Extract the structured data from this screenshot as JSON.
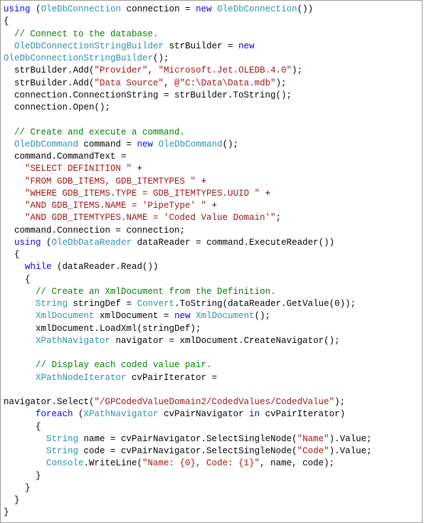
{
  "code": {
    "keywords": {
      "using": "using",
      "new": "new",
      "while": "while",
      "foreach": "foreach",
      "in": "in"
    },
    "types": {
      "OleDbConnection": "OleDbConnection",
      "OleDbConnectionStringBuilder": "OleDbConnectionStringBuilder",
      "OleDbCommand": "OleDbCommand",
      "OleDbDataReader": "OleDbDataReader",
      "String": "String",
      "Convert": "Convert",
      "XmlDocument": "XmlDocument",
      "XPathNavigator": "XPathNavigator",
      "XPathNodeIterator": "XPathNodeIterator",
      "Console": "Console"
    },
    "comments": {
      "c1": "// Connect to the database.",
      "c2": "// Create and execute a command.",
      "c3": "// Create an XmlDocument from the Definition.",
      "c4": "// Display each coded value pair."
    },
    "strings": {
      "provider_key": "\"Provider\"",
      "provider_val": "\"Microsoft.Jet.OLEDB.4.0\"",
      "datasource_key": "\"Data Source\"",
      "datasource_val": "@\"C:\\Data\\Data.mdb\"",
      "sql1": "\"SELECT DEFINITION \"",
      "sql2": "\"FROM GDB_ITEMS, GDB_ITEMTYPES \"",
      "sql3": "\"WHERE GDB_ITEMS.TYPE = GDB_ITEMTYPES.UUID \"",
      "sql4": "\"AND GDB_ITEMS.NAME = 'PipeType' \"",
      "sql5": "\"AND GDB_ITEMTYPES.NAME = 'Coded Value Domain'\"",
      "xpath": "\"/GPCodedValueDomain2/CodedValues/CodedValue\"",
      "name": "\"Name\"",
      "code": "\"Code\"",
      "fmt": "\"Name: {0}, Code: {1}\""
    },
    "plain": {
      "l1a": " (",
      "l1b": " connection = ",
      "l1c": "())",
      "l2": "{",
      "l4a": "  ",
      "l4b": " strBuilder = ",
      "l5a": "();",
      "l6a": "  strBuilder.Add(",
      "l6b": ", ",
      "l6c": ");",
      "l8": "  connection.ConnectionString = strBuilder.ToString();",
      "l9": "  connection.Open();",
      "l12a": " command = ",
      "l12b": "();",
      "l13": "  command.CommandText =",
      "l14a": "    ",
      "l14b": " +",
      "l18b": ";",
      "l19": "  command.Connection = connection;",
      "l20b": " dataReader = command.ExecuteReader())",
      "l21": "  {",
      "l22a": "    ",
      "l22b": " (dataReader.Read())",
      "l23": "    {",
      "l25a": "      ",
      "l25b": " stringDef = ",
      "l25c": ".ToString(dataReader.GetValue(0));",
      "l26b": " xmlDocument = ",
      "l27": "      xmlDocument.LoadXml(stringDef);",
      "l28b": " navigator = xmlDocument.CreateNavigator();",
      "l31b": " cvPairIterator =",
      "l33a": "navigator.Select(",
      "l33b": ");",
      "l34b": " cvPairNavigator ",
      "l34c": " cvPairIterator)",
      "l35": "      {",
      "l36a": "        ",
      "l36b": " name = cvPairNavigator.SelectSingleNode(",
      "l36c": ").Value;",
      "l37b": " code = cvPairNavigator.SelectSingleNode(",
      "l38b": ".WriteLine(",
      "l38c": ", name, code);",
      "l39": "      }",
      "l40": "    }",
      "l41": "  }",
      "l42": "}",
      "sp2": "  ",
      "sp1": " "
    }
  }
}
